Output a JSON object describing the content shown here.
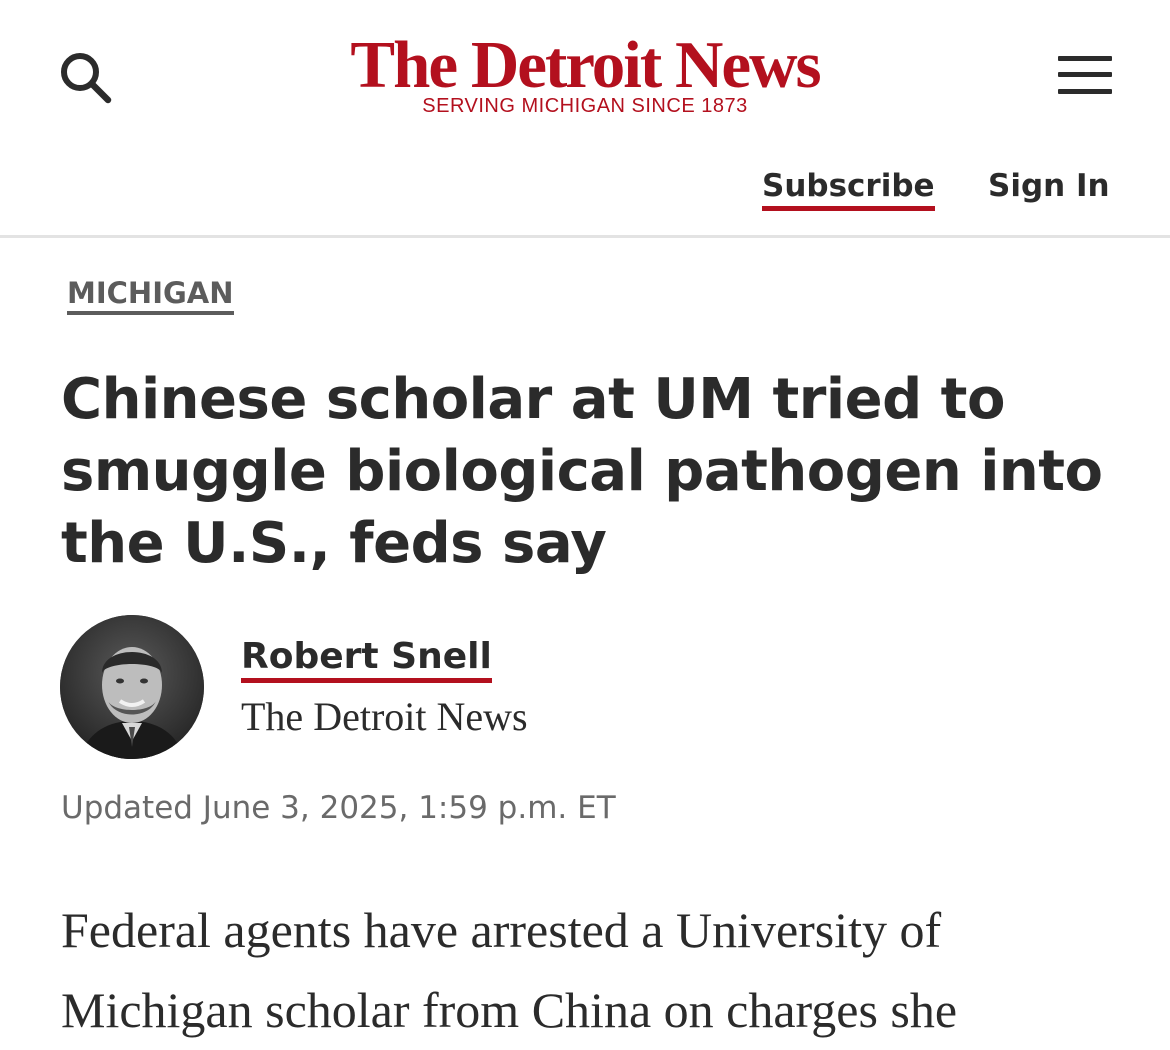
{
  "masthead": {
    "logo_title": "The Detroit News",
    "logo_tagline": "SERVING MICHIGAN SINCE 1873",
    "subscribe_label": "Subscribe",
    "signin_label": "Sign In",
    "search_icon": "search-icon",
    "menu_icon": "hamburger-menu-icon"
  },
  "article": {
    "section": "MICHIGAN",
    "headline": "Chinese scholar at UM tried to smuggle biological pathogen into the U.S., feds say",
    "author": {
      "name": "Robert Snell",
      "organization": "The Detroit News"
    },
    "updated": "Updated June 3, 2025, 1:59 p.m. ET",
    "body_preview": "Federal agents have arrested a University of Michigan scholar from China on charges she"
  },
  "colors": {
    "brand_red": "#b3101e",
    "text": "#2b2b2b",
    "muted": "#6a6a6a"
  }
}
